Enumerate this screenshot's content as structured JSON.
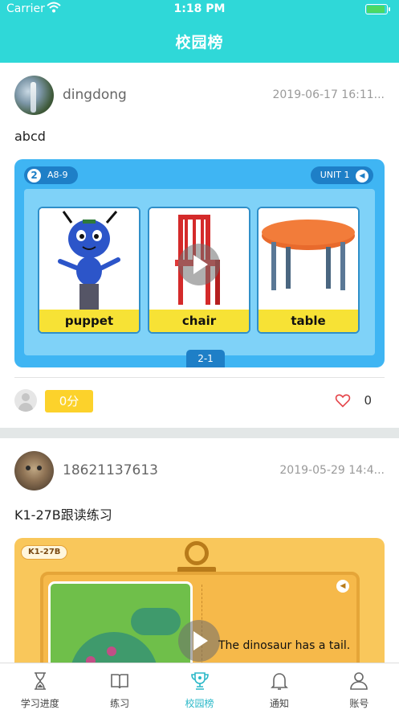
{
  "status_bar": {
    "carrier": "Carrier",
    "time": "1:18 PM",
    "battery_level": 0.9
  },
  "header": {
    "title": "校园榜"
  },
  "posts": [
    {
      "username": "dingdong",
      "timestamp": "2019-06-17 16:11...",
      "caption": "abcd",
      "card": {
        "badge_number": "2",
        "badge_code": "A8-9",
        "unit_label": "UNIT 1",
        "tiles": [
          "puppet",
          "chair",
          "table"
        ],
        "page_label": "2-1"
      },
      "score": "0分",
      "likes": "0"
    },
    {
      "username": "18621137613",
      "timestamp": "2019-05-29 14:4...",
      "caption": "K1-27B跟读练习",
      "card": {
        "tag": "K1-27B",
        "sentence": "The dinosaur has a tail."
      }
    }
  ],
  "tabbar": {
    "items": [
      {
        "label": "学习进度",
        "icon": "hourglass-icon"
      },
      {
        "label": "练习",
        "icon": "book-icon"
      },
      {
        "label": "校园榜",
        "icon": "trophy-icon",
        "active": true
      },
      {
        "label": "通知",
        "icon": "bell-icon"
      },
      {
        "label": "账号",
        "icon": "person-icon"
      }
    ],
    "active_color": "#2bb8c8"
  },
  "colors": {
    "accent": "#2fd8d8",
    "score_badge": "#fcd22b"
  }
}
